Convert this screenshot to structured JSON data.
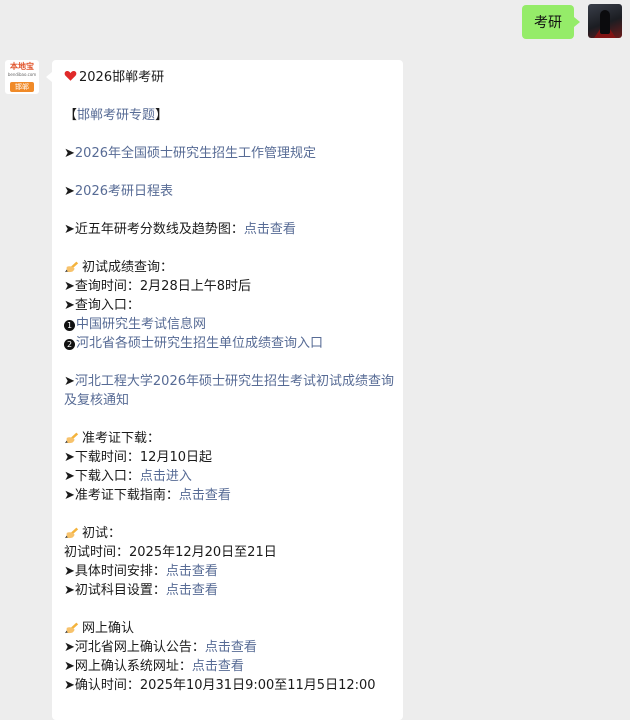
{
  "user_message": "考研",
  "left_avatar": {
    "logo_text": "本地宝",
    "logo_sub": "bendibao.com",
    "badge": "邯郸"
  },
  "message": {
    "title": "2026邯郸考研",
    "topic_open": "【",
    "topic_link": "邯郸考研专题",
    "topic_close": "】",
    "arrow": "➤",
    "link1": "2026年全国硕士研究生招生工作管理规定",
    "link2": "2026考研日程表",
    "score_label": "近五年研考分数线及趋势图：",
    "score_link": "点击查看",
    "s1_title": "初试成绩查询：",
    "s1_time": "查询时间：2月28日上午8时后",
    "s1_entry": "查询入口：",
    "s1_num1": "1",
    "s1_link1": "中国研究生考试信息网",
    "s1_num2": "2",
    "s1_link2": "河北省各硕士研究生招生单位成绩查询入口",
    "link3": "河北工程大学2026年硕士研究生招生考试初试成绩查询及复核通知",
    "s2_title": "准考证下载：",
    "s2_time": "下载时间：12月10日起",
    "s2_entry_label": "下载入口：",
    "s2_entry_link": "点击进入",
    "s2_guide_label": "准考证下载指南：",
    "s2_guide_link": "点击查看",
    "s3_title": "初试：",
    "s3_time": "初试时间：2025年12月20日至21日",
    "s3_sched_label": "具体时间安排：",
    "s3_sched_link": "点击查看",
    "s3_subj_label": "初试科目设置：",
    "s3_subj_link": "点击查看",
    "s4_title": "网上确认",
    "s4_notice_label": "河北省网上确认公告：",
    "s4_notice_link": "点击查看",
    "s4_site_label": "网上确认系统网址：",
    "s4_site_link": "点击查看",
    "s4_time": "确认时间：2025年10月31日9:00至11月5日12:00"
  }
}
